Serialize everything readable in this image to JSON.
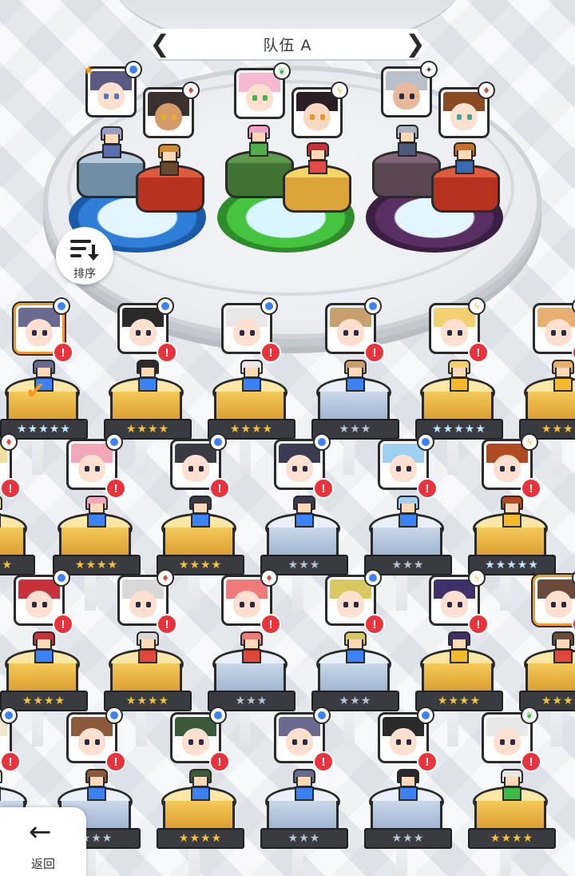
{
  "header": {
    "team_title": "队伍 A"
  },
  "controls": {
    "sort_label": "排序",
    "back_label": "返回"
  },
  "colors": {
    "alert_red": "#e8323c",
    "select_orange": "#f39a1e",
    "element_water": "#3b82f6",
    "element_fire": "#e0463a",
    "element_light": "#f2b92a",
    "element_nature": "#3fb84a",
    "element_dark": "#4a3a6a"
  },
  "team": [
    {
      "element": "water",
      "element_icon": "droplet-icon",
      "star_marker": true
    },
    {
      "element": "fire",
      "element_icon": "fire-diamond-icon"
    },
    {
      "element": "nature",
      "element_icon": "leaf-icon"
    },
    {
      "element": "light",
      "element_icon": "bolt-icon"
    },
    {
      "element": "dark",
      "element_icon": "dark-star-icon"
    },
    {
      "element": "fire",
      "element_icon": "fire-diamond-icon"
    }
  ],
  "roster": {
    "row1": [
      {
        "element": "water",
        "stars": "★★★★★",
        "tier": "rainbow",
        "selected": true,
        "alert": "!"
      },
      {
        "element": "water",
        "stars": "★★★★",
        "tier": "gold",
        "alert": "!"
      },
      {
        "element": "water",
        "stars": "★★★★",
        "tier": "gold",
        "alert": "!"
      },
      {
        "element": "water",
        "stars": "★★★",
        "tier": "silver",
        "alert": "!"
      },
      {
        "element": "light",
        "stars": "★★★★★",
        "tier": "rainbow",
        "alert": "!"
      },
      {
        "element": "light",
        "stars": "★★★★",
        "tier": "gold",
        "alert": "!"
      }
    ],
    "row2": [
      {
        "element": "fire",
        "stars": "★★★★",
        "tier": "gold",
        "alert": "!"
      },
      {
        "element": "water",
        "stars": "★★★★",
        "tier": "gold",
        "alert": "!"
      },
      {
        "element": "water",
        "stars": "★★★★",
        "tier": "gold",
        "alert": "!"
      },
      {
        "element": "water",
        "stars": "★★★",
        "tier": "silver",
        "alert": "!"
      },
      {
        "element": "water",
        "stars": "★★★",
        "tier": "silver",
        "alert": "!"
      },
      {
        "element": "light",
        "stars": "★★★★★",
        "tier": "rainbow",
        "alert": "!"
      }
    ],
    "row3": [
      {
        "element": "water",
        "stars": "★★★★",
        "tier": "gold",
        "alert": "!"
      },
      {
        "element": "fire",
        "stars": "★★★★",
        "tier": "gold",
        "alert": "!"
      },
      {
        "element": "fire",
        "stars": "★★★",
        "tier": "silver",
        "alert": "!"
      },
      {
        "element": "water",
        "stars": "★★★",
        "tier": "silver",
        "alert": "!"
      },
      {
        "element": "light",
        "stars": "★★★★",
        "tier": "gold",
        "alert": "!"
      },
      {
        "element": "fire",
        "stars": "★★★★",
        "tier": "gold",
        "selected": true,
        "alert": "!"
      }
    ],
    "row4": [
      {
        "element": "water",
        "stars": "★★★",
        "tier": "silver",
        "alert": "!"
      },
      {
        "element": "water",
        "stars": "★★★",
        "tier": "silver",
        "alert": "!"
      },
      {
        "element": "water",
        "stars": "★★★★",
        "tier": "gold",
        "alert": "!"
      },
      {
        "element": "water",
        "stars": "★★★",
        "tier": "silver",
        "alert": "!"
      },
      {
        "element": "water",
        "stars": "★★★",
        "tier": "silver",
        "alert": "!"
      },
      {
        "element": "nature",
        "stars": "★★★★",
        "tier": "gold",
        "alert": "!"
      }
    ]
  }
}
